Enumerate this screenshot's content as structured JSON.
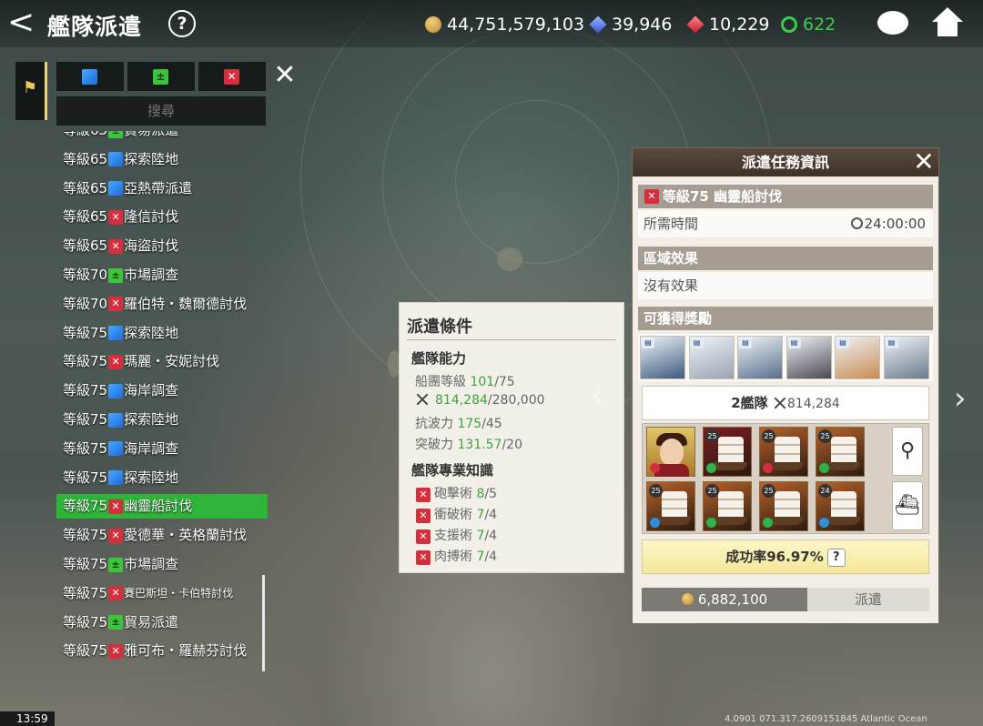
{
  "header": {
    "back": "<",
    "title": "艦隊派遣",
    "help": "?"
  },
  "currencies": [
    {
      "icon": "gold-coin-icon",
      "value": "44,751,579,103",
      "color": "#ffffff"
    },
    {
      "icon": "blue-gem-icon",
      "value": "39,946",
      "color": "#ffffff"
    },
    {
      "icon": "red-gem-icon",
      "value": "10,229",
      "color": "#ffffff"
    },
    {
      "icon": "ship-wheel-icon",
      "value": "622",
      "color": "#38d04a"
    }
  ],
  "filter": {
    "search_placeholder": "搜尋",
    "close": "✕",
    "tabs": [
      {
        "type": "explore",
        "icon": "explore-icon"
      },
      {
        "type": "trade",
        "icon": "trade-icon"
      },
      {
        "type": "battle",
        "icon": "battle-icon"
      }
    ]
  },
  "missions": [
    {
      "level": "等級65",
      "type": "trade",
      "name": "貿易派遣",
      "small": false
    },
    {
      "level": "等級65",
      "type": "explore",
      "name": "探索陸地",
      "small": false
    },
    {
      "level": "等級65",
      "type": "explore",
      "name": "亞熱帶派遣",
      "small": false
    },
    {
      "level": "等級65",
      "type": "battle",
      "name": "隆信討伐",
      "small": false
    },
    {
      "level": "等級65",
      "type": "battle",
      "name": "海盜討伐",
      "small": false
    },
    {
      "level": "等級70",
      "type": "trade",
      "name": "市場調查",
      "small": false
    },
    {
      "level": "等級70",
      "type": "battle",
      "name": "羅伯特・魏爾德討伐",
      "small": false
    },
    {
      "level": "等級75",
      "type": "explore",
      "name": "探索陸地",
      "small": false
    },
    {
      "level": "等級75",
      "type": "battle",
      "name": "瑪麗・安妮討伐",
      "small": false
    },
    {
      "level": "等級75",
      "type": "explore",
      "name": "海岸調查",
      "small": false
    },
    {
      "level": "等級75",
      "type": "explore",
      "name": "探索陸地",
      "small": false
    },
    {
      "level": "等級75",
      "type": "explore",
      "name": "海岸調查",
      "small": false
    },
    {
      "level": "等級75",
      "type": "explore",
      "name": "探索陸地",
      "small": false
    },
    {
      "level": "等級75",
      "type": "battle",
      "name": "幽靈船討伐",
      "small": false,
      "active": true
    },
    {
      "level": "等級75",
      "type": "battle",
      "name": "愛德華・英格蘭討伐",
      "small": false
    },
    {
      "level": "等級75",
      "type": "trade",
      "name": "市場調查",
      "small": false
    },
    {
      "level": "等級75",
      "type": "battle",
      "name": "賽巴斯坦・卡伯特討伐",
      "small": true
    },
    {
      "level": "等級75",
      "type": "trade",
      "name": "貿易派遣",
      "small": false
    },
    {
      "level": "等級75",
      "type": "battle",
      "name": "雅可布・羅赫芬討伐",
      "small": false
    }
  ],
  "conditions": {
    "title": "派遣條件",
    "fleet_section": "艦隊能力",
    "fleet_rows": [
      {
        "label": "船團等級 ",
        "current": "101",
        "required": "/75",
        "icon": ""
      },
      {
        "label": "",
        "current": "814,284",
        "required": "/280,000",
        "icon": "crossed-swords-icon"
      },
      {
        "label": "抗波力 ",
        "current": "175",
        "required": "/45",
        "icon": ""
      },
      {
        "label": "突破力 ",
        "current": "131.57",
        "required": "/20",
        "icon": ""
      }
    ],
    "skill_section": "艦隊專業知識",
    "skill_rows": [
      {
        "label": "砲擊術 ",
        "current": "8",
        "required": "/5"
      },
      {
        "label": "衝破術 ",
        "current": "7",
        "required": "/4"
      },
      {
        "label": "支援術 ",
        "current": "7",
        "required": "/4"
      },
      {
        "label": "肉搏術 ",
        "current": "7",
        "required": "/4"
      }
    ]
  },
  "info": {
    "header": "派遣任務資訊",
    "close": "✕",
    "mission_title": "等級75 幽靈船討伐",
    "time_label": "所需時間",
    "time_value": "24:00:00",
    "region_title": "區域效果",
    "region_value": "沒有效果",
    "reward_title": "可獲得獎勵",
    "rewards": [
      {
        "icon": "sea-creature-icon",
        "color": "#3e5a7e"
      },
      {
        "icon": "sail-cloth-icon",
        "color": "#9aa4b0"
      },
      {
        "icon": "wing-armor-icon",
        "color": "#5a6f8c"
      },
      {
        "icon": "cannon-icon",
        "color": "#4a4a52"
      },
      {
        "icon": "wood-planks-icon",
        "color": "#c98c54"
      },
      {
        "icon": "anchor-icon",
        "color": "#6b7a8c"
      }
    ],
    "fleet_label": "2艦隊",
    "fleet_power": "814,284",
    "ships": [
      {
        "kind": "captain",
        "level": "",
        "bg": "#c49d3b",
        "tag": "#d62e3c"
      },
      {
        "kind": "ship",
        "level": "25",
        "bg": "#7a1e22",
        "tag": "#2db34a"
      },
      {
        "kind": "ship",
        "level": "25",
        "bg": "#b5632a",
        "tag": "#d62e3c"
      },
      {
        "kind": "ship",
        "level": "25",
        "bg": "#b5632a",
        "tag": "#2db34a"
      },
      {
        "kind": "ship",
        "level": "25",
        "bg": "#b5632a",
        "tag": "#2e8ed8"
      },
      {
        "kind": "ship",
        "level": "25",
        "bg": "#b5632a",
        "tag": "#2db34a"
      },
      {
        "kind": "ship",
        "level": "25",
        "bg": "#b5632a",
        "tag": "#2db34a"
      },
      {
        "kind": "ship",
        "level": "24",
        "bg": "#b5632a",
        "tag": "#2e8ed8"
      }
    ],
    "success_rate": "成功率96.97%",
    "cost": "6,882,100",
    "dispatch": "派遣"
  },
  "status": {
    "time": "13:59",
    "coords": "4.0901 071.317.2609151845 Atlantic Ocean"
  }
}
